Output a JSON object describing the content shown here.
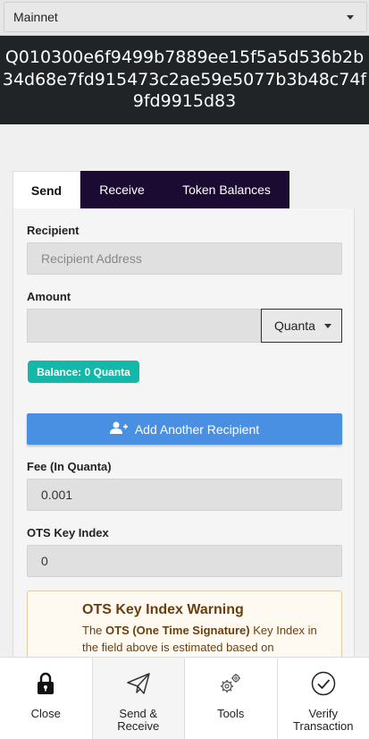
{
  "network": {
    "selected": "Mainnet"
  },
  "wallet": {
    "address": "Q010300e6f9499b7889ee15f5a5d536b2b34d68e7fd915473c2ae59e5077b3b48c74f9fd9915d83"
  },
  "tabs": [
    {
      "label": "Send"
    },
    {
      "label": "Receive"
    },
    {
      "label": "Token Balances"
    }
  ],
  "form": {
    "recipient_label": "Recipient",
    "recipient_placeholder": "Recipient Address",
    "amount_label": "Amount",
    "amount_value": "",
    "unit": "Quanta",
    "balance": "Balance: 0 Quanta",
    "add_recipient": "Add Another Recipient",
    "fee_label": "Fee (In Quanta)",
    "fee_value": "0.001",
    "ots_label": "OTS Key Index",
    "ots_value": "0"
  },
  "warning": {
    "title": "OTS Key Index Warning",
    "text_prefix": "The ",
    "text_bold": "OTS (One Time Signature)",
    "text_suffix": " Key Index in the field above is estimated based on"
  },
  "nav": [
    {
      "label": "Close",
      "icon": "lock-icon"
    },
    {
      "label": "Send & Receive",
      "icon": "paper-plane-icon"
    },
    {
      "label": "Tools",
      "icon": "gears-icon"
    },
    {
      "label": "Verify Transaction",
      "icon": "check-circle-icon"
    }
  ],
  "colors": {
    "banner_bg": "#202427",
    "tab_bg": "#1b0b33",
    "balance_badge": "#14b8a8",
    "add_button": "#4a90e2",
    "warning_text": "#6a3f10"
  }
}
